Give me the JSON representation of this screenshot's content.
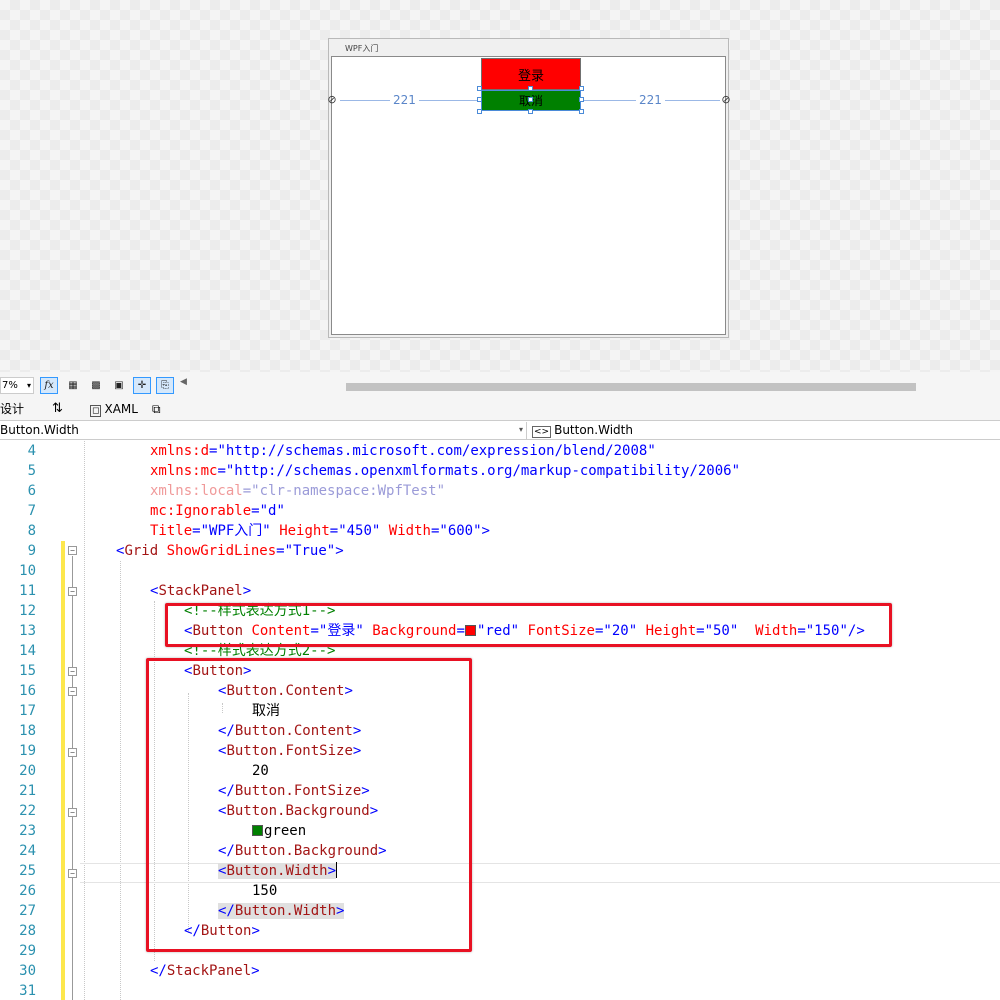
{
  "designer": {
    "window_title": "WPF入门",
    "login_button": "登录",
    "cancel_button": "取消",
    "left_margin": "221",
    "right_margin": "221"
  },
  "toolbar": {
    "zoom": "7%",
    "fx_label": "fx"
  },
  "tabs": {
    "design": "设计",
    "swap": "⇅",
    "xaml": "XAML"
  },
  "nav": {
    "scope": "Button.Width",
    "member": "Button.Width"
  },
  "colors": {
    "login_bg": "#ff0000",
    "cancel_bg": "#008000",
    "highlight_box": "#e81123",
    "change_bar": "#fde74c"
  },
  "code": {
    "line_numbers": [
      "4",
      "5",
      "6",
      "7",
      "8",
      "9",
      "10",
      "11",
      "12",
      "13",
      "14",
      "15",
      "16",
      "17",
      "18",
      "19",
      "20",
      "21",
      "22",
      "23",
      "24",
      "25",
      "26",
      "27",
      "28",
      "29",
      "30",
      "31"
    ],
    "l4": {
      "attr": "xmlns:d",
      "eq": "=",
      "val": "\"http://schemas.microsoft.com/expression/blend/2008\""
    },
    "l5": {
      "attr": "xmlns:mc",
      "eq": "=",
      "val": "\"http://schemas.openxmlformats.org/markup-compatibility/2006\""
    },
    "l6": {
      "attr": "xmlns:local",
      "eq": "=",
      "val": "\"clr-namespace:WpfTest\""
    },
    "l7": {
      "attr": "mc:Ignorable",
      "eq": "=",
      "val": "\"d\""
    },
    "l8": {
      "a1": "Title",
      "v1": "\"WPF入门\"",
      "a2": "Height",
      "v2": "\"450\"",
      "a3": "Width",
      "v3": "\"600\"",
      "end": ">"
    },
    "l9": {
      "open": "<",
      "name": "Grid",
      "attr": "ShowGridLines",
      "val": "\"True\"",
      "close": ">"
    },
    "l11": {
      "open": "<",
      "name": "StackPanel",
      "close": ">"
    },
    "l12": "<!--样式表达方式1-->",
    "l13": {
      "open": "<",
      "name": "Button",
      "a1": "Content",
      "v1": "\"登录\"",
      "a2": "Background",
      "v2": "\"red\"",
      "a3": "FontSize",
      "v3": "\"20\"",
      "a4": "Height",
      "v4": "\"50\"",
      "a5": "Width",
      "v5": "\"150\"",
      "close": "/>"
    },
    "l14": "<!--样式表达方式2-->",
    "l15": {
      "open": "<",
      "name": "Button",
      "close": ">"
    },
    "l16": {
      "open": "<",
      "name": "Button.Content",
      "close": ">"
    },
    "l17": "取消",
    "l18": {
      "open": "</",
      "name": "Button.Content",
      "close": ">"
    },
    "l19": {
      "open": "<",
      "name": "Button.FontSize",
      "close": ">"
    },
    "l20": "20",
    "l21": {
      "open": "</",
      "name": "Button.FontSize",
      "close": ">"
    },
    "l22": {
      "open": "<",
      "name": "Button.Background",
      "close": ">"
    },
    "l23": "green",
    "l24": {
      "open": "</",
      "name": "Button.Background",
      "close": ">"
    },
    "l25": {
      "open": "<",
      "name": "Button.Width",
      "close": ">"
    },
    "l26": "150",
    "l27": {
      "open": "</",
      "name": "Button.Width",
      "close": ">"
    },
    "l28": {
      "open": "</",
      "name": "Button",
      "close": ">"
    },
    "l30": {
      "open": "</",
      "name": "StackPanel",
      "close": ">"
    }
  }
}
